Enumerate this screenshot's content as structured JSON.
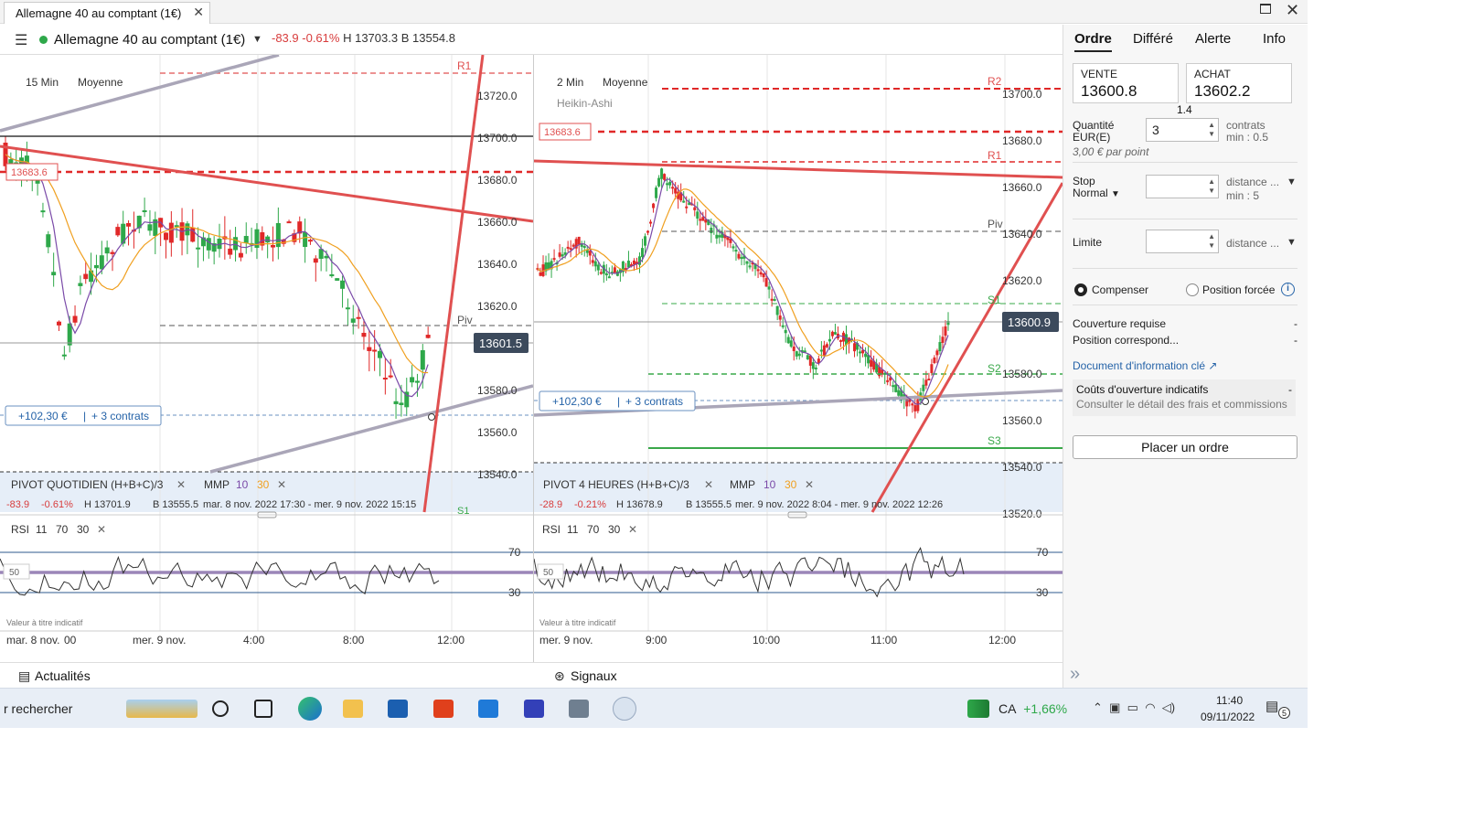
{
  "window": {
    "tab_title": "Allemagne 40 au comptant (1€)",
    "close": "✕",
    "maximize": "☐",
    "close_win": "✕"
  },
  "header": {
    "instrument": "Allemagne 40 au comptant (1€)",
    "change": "-83.9",
    "change_pct": "-0.61%",
    "high": "H 13703.3",
    "low": "B 13554.8"
  },
  "left_chart": {
    "timeframe": "15 Min",
    "avg_label": "Moyenne",
    "price_labels": [
      "13720.0",
      "13700.0",
      "13680.0",
      "13660.0",
      "13640.0",
      "13620.0",
      "13600.0",
      "13580.0",
      "13560.0",
      "13540.0"
    ],
    "current_price": "13601.5",
    "pivot_tag": "13683.6",
    "r1": "R1",
    "piv": "Piv",
    "s1": "S1",
    "position_label": "+102,30 €",
    "position_contracts": "+ 3 contrats",
    "indicator_pivot": "PIVOT QUOTIDIEN (H+B+C)/3",
    "indicator_mmp": "MMP",
    "mmp_p1": "10",
    "mmp_p2": "30",
    "stat_change": "-83.9",
    "stat_pct": "-0.61%",
    "stat_high": "H 13701.9",
    "stat_low": "B 13555.5",
    "stat_range": "mar. 8 nov. 2022 17:30 - mer. 9 nov. 2022 15:15",
    "rsi_label": "RSI",
    "rsi_p1": "11",
    "rsi_p2": "70",
    "rsi_p3": "30",
    "rsi_70": "70",
    "rsi_50": "50",
    "rsi_30": "30",
    "note": "Valeur à titre indicatif",
    "time_labels": [
      "mar. 8 nov.",
      "00",
      "mer. 9 nov.",
      "4:00",
      "8:00",
      "12:00"
    ]
  },
  "right_chart": {
    "timeframe": "2 Min",
    "avg_label": "Moyenne",
    "style_label": "Heikin-Ashi",
    "price_labels": [
      "13700.0",
      "13680.0",
      "13660.0",
      "13640.0",
      "13620.0",
      "13600.0",
      "13580.0",
      "13560.0",
      "13540.0",
      "13520.0"
    ],
    "current_price": "13600.9",
    "pivot_tag": "13683.6",
    "r2": "R2",
    "r1": "R1",
    "piv": "Piv",
    "s1": "S1",
    "s2": "S2",
    "s3": "S3",
    "position_label": "+102,30 €",
    "position_contracts": "+ 3 contrats",
    "indicator_pivot": "PIVOT 4 HEURES (H+B+C)/3",
    "indicator_mmp": "MMP",
    "mmp_p1": "10",
    "mmp_p2": "30",
    "stat_change": "-28.9",
    "stat_pct": "-0.21%",
    "stat_high": "H 13678.9",
    "stat_low": "B 13555.5",
    "stat_range": "mer. 9 nov. 2022 8:04 - mer. 9 nov. 2022 12:26",
    "rsi_label": "RSI",
    "rsi_p1": "11",
    "rsi_p2": "70",
    "rsi_p3": "30",
    "rsi_70": "70",
    "rsi_50": "50",
    "rsi_30": "30",
    "note": "Valeur à titre indicatif",
    "time_labels": [
      "mer. 9 nov.",
      "9:00",
      "10:00",
      "11:00",
      "12:00"
    ]
  },
  "bottom": {
    "news": "Actualités",
    "signals": "Signaux"
  },
  "panel": {
    "tabs": [
      "Ordre",
      "Différé",
      "Alerte",
      "Info"
    ],
    "sell_label": "VENTE",
    "sell_value": "13600.8",
    "buy_label": "ACHAT",
    "buy_value": "13602.2",
    "spread": "1.4",
    "qty_label": "Quantité",
    "qty_unit": "EUR(E)",
    "qty_value": "3",
    "qty_contracts": "contrats",
    "qty_min": "min : 0.5",
    "per_point": "3,00 € par point",
    "stop_label": "Stop",
    "stop_type": "Normal",
    "stop_distance": "distance ...",
    "stop_min": "min : 5",
    "limit_label": "Limite",
    "limit_distance": "distance ...",
    "opt_compensate": "Compenser",
    "opt_forced": "Position forcée",
    "info_i": "i",
    "cover_label": "Couverture requise",
    "cover_value": "-",
    "position_label": "Position correspond...",
    "position_value": "-",
    "doc_link": "Document d'information clé",
    "costs_title": "Coûts d'ouverture indicatifs",
    "costs_value": "-",
    "costs_sub": "Consulter le détail des frais et commissions",
    "place_order": "Placer un ordre"
  },
  "taskbar": {
    "search": "r rechercher",
    "market": "CA",
    "market_change": "+1,66%",
    "time": "11:40",
    "date": "09/11/2022",
    "notif": "5"
  },
  "colors": {
    "bull": "#2ea84a",
    "bear": "#e02828",
    "pivot_red": "#e05050",
    "support_green": "#3aa84a",
    "rsi": "#333",
    "link": "#2563a8"
  }
}
